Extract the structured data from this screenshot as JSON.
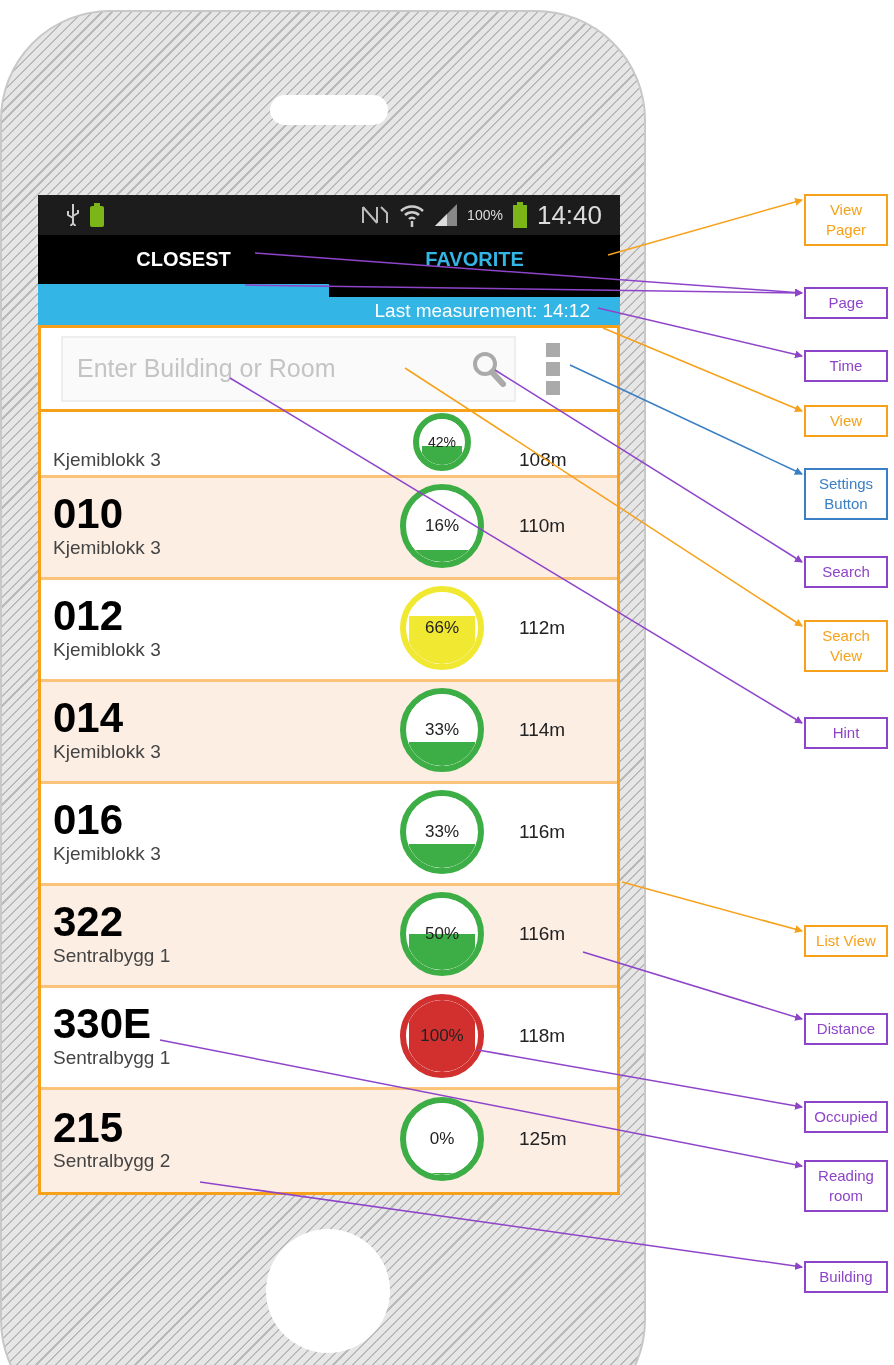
{
  "status_bar": {
    "battery_percent": "100%",
    "time": "14:40"
  },
  "tabs": [
    {
      "label": "CLOSEST",
      "selected": true
    },
    {
      "label": "FAVORITE",
      "selected": false
    }
  ],
  "last_measurement": "Last measurement: 14:12",
  "search": {
    "placeholder": "Enter Building or Room"
  },
  "rows": [
    {
      "building": "Kjemiblokk 3",
      "occupancy": "42%",
      "level": 0.42,
      "color": "#3dae45",
      "distance": "108m"
    },
    {
      "room": "010",
      "building": "Kjemiblokk 3",
      "occupancy": "16%",
      "level": 0.16,
      "color": "#3dae45",
      "distance": "110m"
    },
    {
      "room": "012",
      "building": "Kjemiblokk 3",
      "occupancy": "66%",
      "level": 0.66,
      "color": "#f1e832",
      "distance": "112m"
    },
    {
      "room": "014",
      "building": "Kjemiblokk 3",
      "occupancy": "33%",
      "level": 0.33,
      "color": "#3dae45",
      "distance": "114m"
    },
    {
      "room": "016",
      "building": "Kjemiblokk 3",
      "occupancy": "33%",
      "level": 0.33,
      "color": "#3dae45",
      "distance": "116m"
    },
    {
      "room": "322",
      "building": "Sentralbygg 1",
      "occupancy": "50%",
      "level": 0.5,
      "color": "#3dae45",
      "distance": "116m"
    },
    {
      "room": "330E",
      "building": "Sentralbygg 1",
      "occupancy": "100%",
      "level": 1,
      "color": "#d22f2f",
      "distance": "118m"
    },
    {
      "room": "215",
      "building": "Sentralbygg 2",
      "occupancy": "0%",
      "level": 0,
      "color": "#3dae45",
      "distance": "125m"
    }
  ],
  "annotations": [
    {
      "label": "View Pager",
      "color": "#f7a11a"
    },
    {
      "label": "Page",
      "color": "#8e44c9"
    },
    {
      "label": "Time",
      "color": "#8e44c9"
    },
    {
      "label": "View",
      "color": "#f7a11a"
    },
    {
      "label": "Settings Button",
      "color": "#3a7fc4"
    },
    {
      "label": "Search",
      "color": "#8e44c9"
    },
    {
      "label": "Search View",
      "color": "#f7a11a"
    },
    {
      "label": "Hint",
      "color": "#8e44c9"
    },
    {
      "label": "List View",
      "color": "#f7a11a"
    },
    {
      "label": "Distance",
      "color": "#8e44c9"
    },
    {
      "label": "Occupied",
      "color": "#8e44c9"
    },
    {
      "label": "Reading room",
      "color": "#8e44c9"
    },
    {
      "label": "Building",
      "color": "#8e44c9"
    }
  ]
}
